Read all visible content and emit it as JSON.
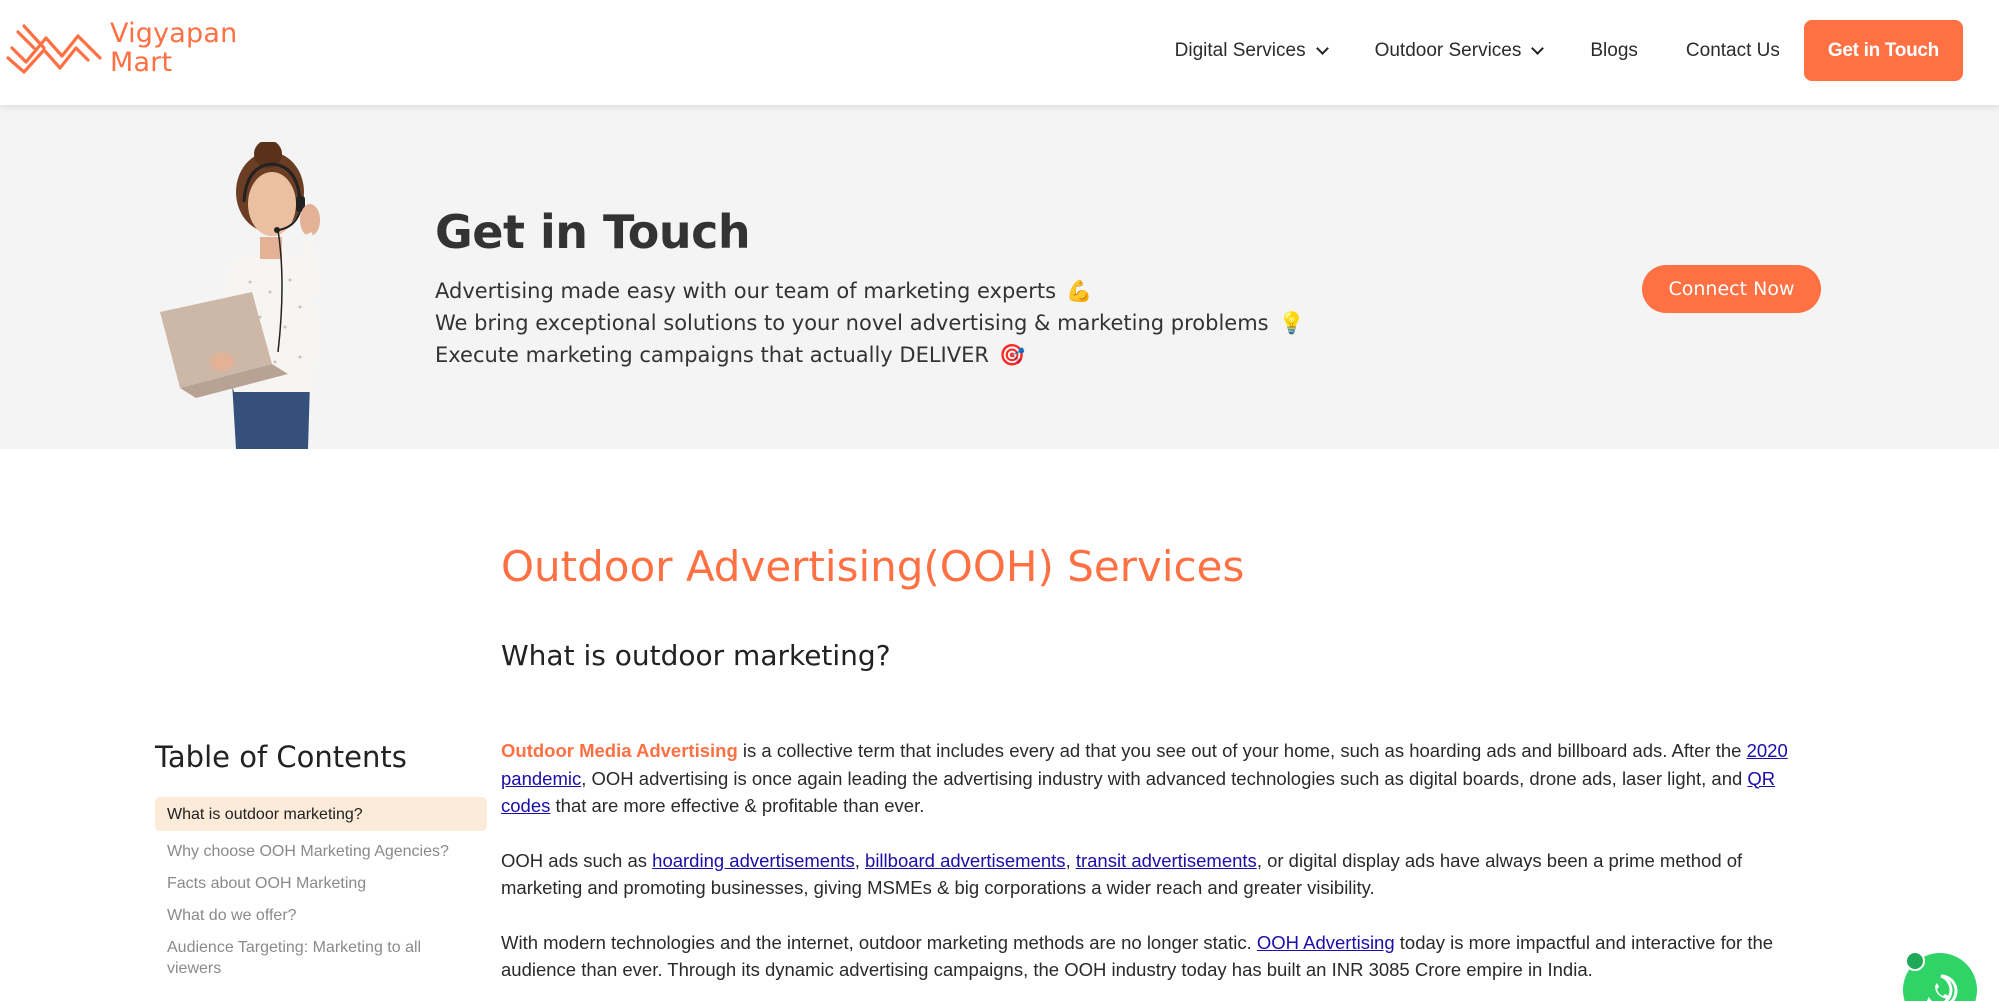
{
  "header": {
    "logo_line1": "Vigyapan",
    "logo_line2": "Mart",
    "nav": [
      {
        "label": "Digital Services",
        "dropdown": true
      },
      {
        "label": "Outdoor Services",
        "dropdown": true
      },
      {
        "label": "Blogs",
        "dropdown": false
      },
      {
        "label": "Contact Us",
        "dropdown": false
      }
    ],
    "cta": "Get in Touch"
  },
  "banner": {
    "title": "Get in Touch",
    "lines": [
      {
        "text": "Advertising made easy with our team of marketing experts",
        "emoji": "💪"
      },
      {
        "text": "We bring exceptional solutions to your novel advertising & marketing problems",
        "emoji": "💡"
      },
      {
        "text": "Execute marketing campaigns that actually DELIVER",
        "emoji": "🎯"
      }
    ],
    "cta": "Connect Now"
  },
  "main": {
    "heading": "Outdoor Advertising(OOH) Services",
    "subheading": "What is outdoor marketing?",
    "p1": {
      "highlight": "Outdoor Media Advertising",
      "t1": " is a collective term that includes every ad that you see out of your home, such as hoarding ads and billboard ads. After the ",
      "link1": "2020 pandemic",
      "t2": ", OOH advertising is once again leading the advertising industry with advanced technologies such as digital boards, drone ads, laser light, and ",
      "link2": "QR codes",
      "t3": " that are more effective & profitable than ever."
    },
    "p2": {
      "t1": "OOH ads such as ",
      "link1": "hoarding advertisements",
      "sep1": ", ",
      "link2": "billboard advertisements",
      "sep2": ", ",
      "link3": "transit advertisements",
      "t2": ", or digital display ads have always been a prime method of marketing and promoting businesses, giving MSMEs & big corporations a wider reach and greater visibility."
    },
    "p3": {
      "t1": "With modern technologies and the internet, outdoor marketing methods are no longer static. ",
      "link1": "OOH Advertising",
      "t2": " today is more impactful and interactive for the audience than ever. Through its dynamic advertising campaigns, the OOH industry today has built an INR 3085 Crore empire in India."
    }
  },
  "toc": {
    "title": "Table of Contents",
    "items": [
      "What is outdoor marketing?",
      "Why choose OOH Marketing Agencies?",
      "Facts about OOH Marketing",
      "What do we offer?",
      "Audience Targeting: Marketing to all viewers"
    ],
    "active_index": 0
  },
  "colors": {
    "accent": "#ff7043",
    "banner_bg": "#f4f4f5",
    "toc_active_bg": "#fcebd8",
    "link": "#1a0dab",
    "whatsapp": "#2fd366"
  },
  "icons": [
    "vigyapan-mart-logo-icon",
    "chevron-down-icon",
    "whatsapp-icon"
  ]
}
